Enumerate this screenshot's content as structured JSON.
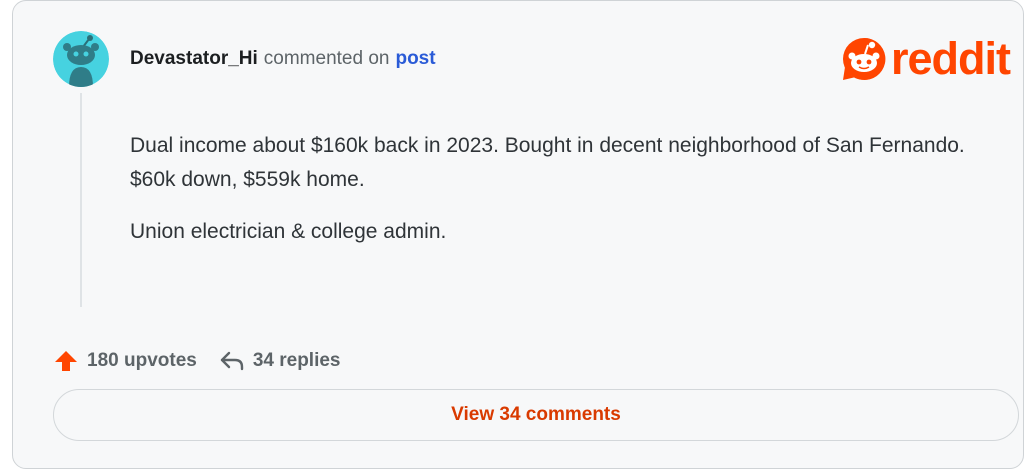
{
  "comment": {
    "author": "Devastator_Hi",
    "action_text": "commented on",
    "post_link": "post",
    "body": [
      "Dual income about $160k back in 2023. Bought in decent neighborhood of San Fernando. $60k down, $559k home.",
      "Union electrician & college admin."
    ]
  },
  "brand": {
    "logo_text": "reddit",
    "color": "#ff4500"
  },
  "footer": {
    "upvotes": "180 upvotes",
    "replies": "34 replies"
  },
  "view_button": {
    "label": "View 34 comments"
  },
  "icons": {
    "avatar": "snoo-avatar-icon",
    "logo": "reddit-snoo-icon",
    "upvote": "upvote-arrow-icon",
    "reply": "reply-arrow-icon"
  }
}
